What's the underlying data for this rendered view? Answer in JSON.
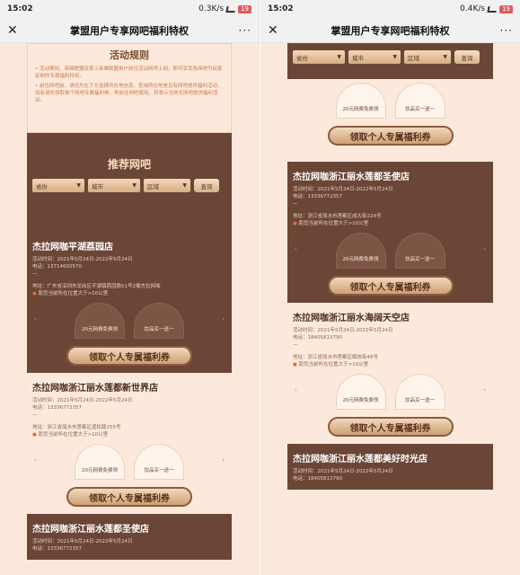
{
  "left": {
    "status": {
      "time": "15:02",
      "speed": "0.3K/s",
      "battery": "19"
    },
    "nav": {
      "close": "✕",
      "title": "掌盟用户专享网吧福利特权",
      "more": "···"
    },
    "rules": {
      "title": "活动规则",
      "p1": "• 活动期间，英雄联盟及掌上英雄联盟用户前往活动网吧上网，即可享受各网吧为玩家定制的专属福利特权。",
      "p2": "• 前往网吧前，请优先在下方选择所在地信息，查询所在地是否有网吧提供福利活动，如有请先领取单个网吧专属福利券，再前往网吧使用，到表示当地无网吧提供福利活动。"
    },
    "recommend": {
      "title": "推荐网吧"
    },
    "filters": {
      "province": "省份",
      "city": "城市",
      "district": "区域",
      "query": "查询"
    },
    "cards": [
      {
        "name": "杰拉网咖平湖荔园店",
        "period": "活动时间：2021年5月24日-2022年5月24日",
        "phone": "电话：13714650570",
        "dash": "—",
        "address": "地址：广东省深圳市龙岗区平湖镇荔园路51号2楼杰拉网咖",
        "distance": "距您当前所在位置大于>10公里",
        "offer1": "20元网费免费领",
        "offer2": "饮品买一送一",
        "claim": "领取个人专属福利券",
        "dark": true
      },
      {
        "name": "杰拉网咖浙江丽水莲都新世界店",
        "period": "活动时间：2021年5月24日-2022年5月24日",
        "phone": "电话：13336772357",
        "dash": "—",
        "address": "地址：浙江省丽水市莲都区遗松路255号",
        "distance": "距您当前所在位置大于>10公里",
        "offer1": "20元网费免费领",
        "offer2": "饮品买一送一",
        "claim": "领取个人专属福利券",
        "dark": false
      },
      {
        "name": "杰拉网咖浙江丽水莲都圣使店",
        "period": "活动时间：2021年5月24日-2022年5月24日",
        "phone": "电话：13336772357",
        "dash": "",
        "address": "",
        "distance": "",
        "offer1": "",
        "offer2": "",
        "claim": "",
        "dark": true
      }
    ]
  },
  "right": {
    "status": {
      "time": "15:02",
      "speed": "0.4K/s",
      "battery": "19"
    },
    "nav": {
      "close": "✕",
      "title": "掌盟用户专享网吧福利特权",
      "more": "···"
    },
    "filters": {
      "province": "省份",
      "city": "城市",
      "district": "区域",
      "query": "查询"
    },
    "top_offers": {
      "offer1": "20元网费免费领",
      "offer2": "饮品买一送一",
      "claim": "领取个人专属福利券"
    },
    "cards": [
      {
        "name": "杰拉网咖浙江丽水莲都圣使店",
        "period": "活动时间：2021年5月24日-2022年5月24日",
        "phone": "电话：13336772357",
        "dash": "—",
        "address": "地址：浙江省丽水市莲都区成大街224号",
        "distance": "距您当前所在位置大于>10公里",
        "offer1": "20元网费免费领",
        "offer2": "饮品买一送一",
        "claim": "领取个人专属福利券",
        "dark": true
      },
      {
        "name": "杰拉网咖浙江丽水海阔天空店",
        "period": "活动时间：2021年5月24日-2022年5月24日",
        "phone": "电话：18405813790",
        "dash": "—",
        "address": "地址：浙江省丽水市莲都区解放街48号",
        "distance": "距您当前所在位置大于>10公里",
        "offer1": "20元网费免费领",
        "offer2": "饮品买一送一",
        "claim": "领取个人专属福利券",
        "dark": false
      },
      {
        "name": "杰拉网咖浙江丽水莲都美好时光店",
        "period": "活动时间：2021年5月24日-2022年5月24日",
        "phone": "电话：18405813790",
        "dash": "",
        "address": "",
        "distance": "",
        "offer1": "",
        "offer2": "",
        "claim": "",
        "dark": true
      }
    ]
  }
}
